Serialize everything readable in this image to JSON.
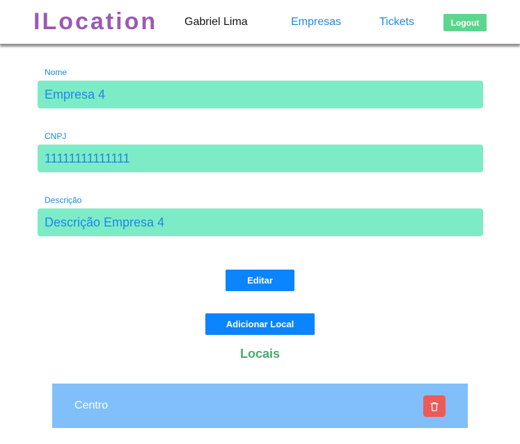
{
  "header": {
    "brand": "ILocation",
    "user_name": "Gabriel Lima",
    "nav": {
      "empresas": "Empresas",
      "tickets": "Tickets"
    },
    "logout_label": "Logout"
  },
  "form": {
    "nome": {
      "label": "Nome",
      "value": "Empresa 4"
    },
    "cnpj": {
      "label": "CNPJ",
      "value": "11111111111111"
    },
    "descricao": {
      "label": "Descrição",
      "value": "Descrição Empresa 4"
    },
    "edit_label": "Editar"
  },
  "add_local_label": "Adicionar Local",
  "locais": {
    "title": "Locais",
    "items": [
      {
        "name": "Centro",
        "action_icon": "trash-icon"
      }
    ]
  },
  "colors": {
    "brand": "#9b59b6",
    "link": "#1e88e5",
    "input_bg": "#7debc6",
    "primary_button": "#0b84ff",
    "logout_button": "#5cd68d",
    "section_title": "#4ca86a",
    "list_item_bg": "#80bffa",
    "delete_button": "#ec5a5a"
  }
}
